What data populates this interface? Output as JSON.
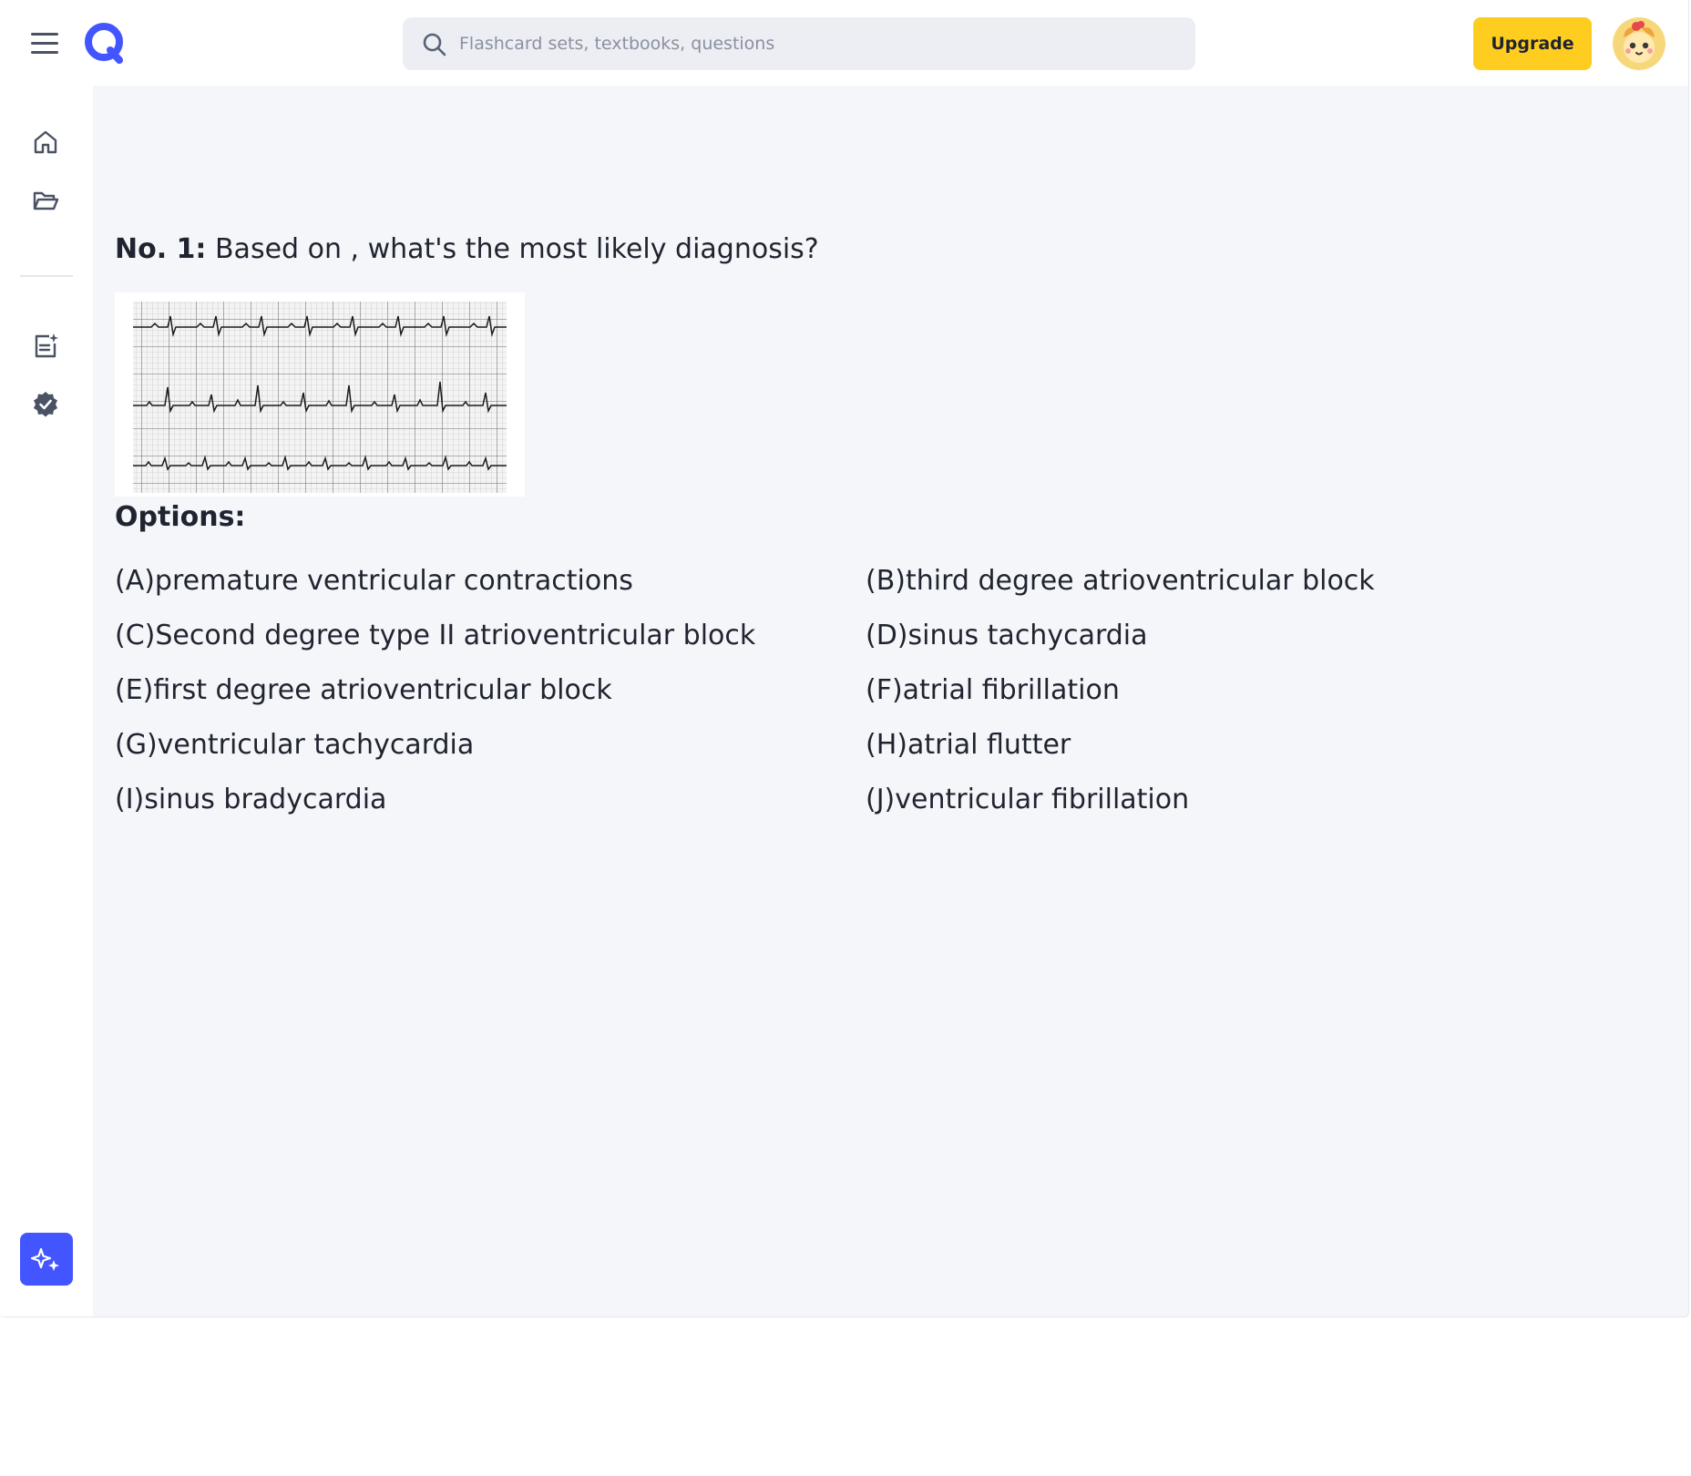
{
  "app": {
    "brand_color": "#4255ff",
    "accent_color": "#ffcd1f"
  },
  "header": {
    "menu_icon": "hamburger-menu-icon",
    "logo_icon": "quizlet-q-logo-icon",
    "search": {
      "icon": "search-icon",
      "placeholder": "Flashcard sets, textbooks, questions",
      "value": ""
    },
    "upgrade_label": "Upgrade",
    "avatar_icon": "user-avatar-icon"
  },
  "sidebar": {
    "items": [
      {
        "name": "sidebar-item-home",
        "icon": "home-icon"
      },
      {
        "name": "sidebar-item-folders",
        "icon": "folder-open-icon"
      },
      {
        "name": "sidebar-item-notes",
        "icon": "notes-sparkle-icon"
      },
      {
        "name": "sidebar-item-verified",
        "icon": "verified-badge-icon"
      }
    ],
    "ai_button_icon": "sparkles-icon"
  },
  "question": {
    "number_label": "No. 1:",
    "text": " Based on , what's the most likely diagnosis?",
    "image_icon": "ecg-strip-image"
  },
  "options": {
    "title": "Options:",
    "items": [
      "(A)premature ventricular contractions",
      "(B)third degree atrioventricular block",
      "(C)Second degree type II atrioventricular block",
      "(D)sinus tachycardia",
      "(E)first degree atrioventricular block",
      "(F)atrial fibrillation",
      "(G)ventricular tachycardia",
      "(H)atrial flutter",
      "(I)sinus bradycardia",
      "(J)ventricular fibrillation"
    ]
  }
}
